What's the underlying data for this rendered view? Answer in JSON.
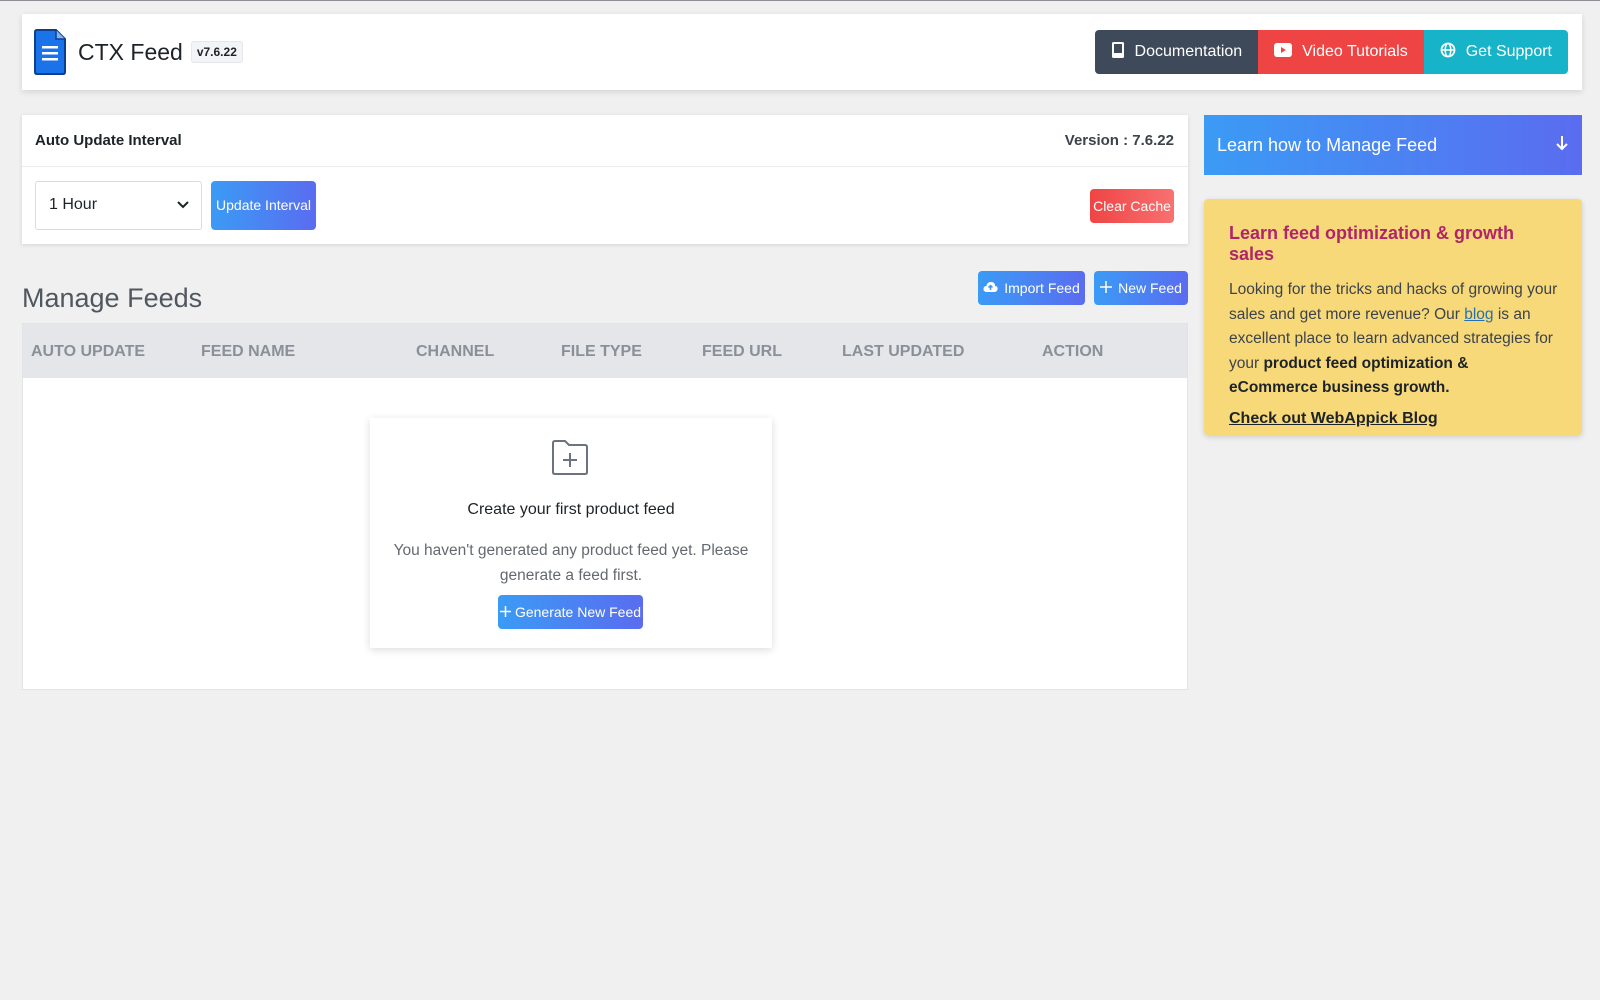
{
  "header": {
    "title": "CTX Feed",
    "version_badge": "v7.6.22",
    "buttons": {
      "documentation": "Documentation",
      "video_tutorials": "Video Tutorials",
      "get_support": "Get Support"
    }
  },
  "interval": {
    "title": "Auto Update Interval",
    "version_text": "Version : 7.6.22",
    "selected": "1 Hour",
    "update_label": "Update Interval",
    "clear_cache_label": "Clear Cache"
  },
  "manage": {
    "title": "Manage Feeds",
    "import_label": "Import Feed",
    "new_label": "New Feed",
    "columns": [
      "AUTO UPDATE",
      "FEED NAME",
      "CHANNEL",
      "FILE TYPE",
      "FEED URL",
      "LAST UPDATED",
      "ACTION"
    ],
    "empty": {
      "title": "Create your first product feed",
      "description": "You haven't generated any product feed yet. Please generate a feed first.",
      "button": "Generate New Feed"
    }
  },
  "sidebar": {
    "banner": "Learn how to Manage Feed",
    "promo": {
      "title": "Learn feed optimization & growth sales",
      "text_1": "Looking for the tricks and hacks of growing your sales and get more revenue? Our ",
      "link": "blog",
      "text_2": " is an excellent place to learn advanced strategies for your ",
      "bold": "product feed optimization & eCommerce business growth.",
      "cta": "Check out WebAppick Blog"
    }
  },
  "icons": {
    "logo": "document-icon",
    "documentation": "book-icon",
    "video": "youtube-icon",
    "support": "globe-icon",
    "import": "cloud-upload-icon",
    "new": "plus-icon",
    "empty": "folder-plus-icon",
    "banner": "arrow-down-icon"
  },
  "colors": {
    "accent_start": "#3b9bf5",
    "accent_end": "#5a6cf0",
    "danger": "#ef4444",
    "support": "#17b3c9",
    "dark": "#3e4a5a",
    "promo_bg": "#f8d97a",
    "promo_title": "#b0246a"
  }
}
